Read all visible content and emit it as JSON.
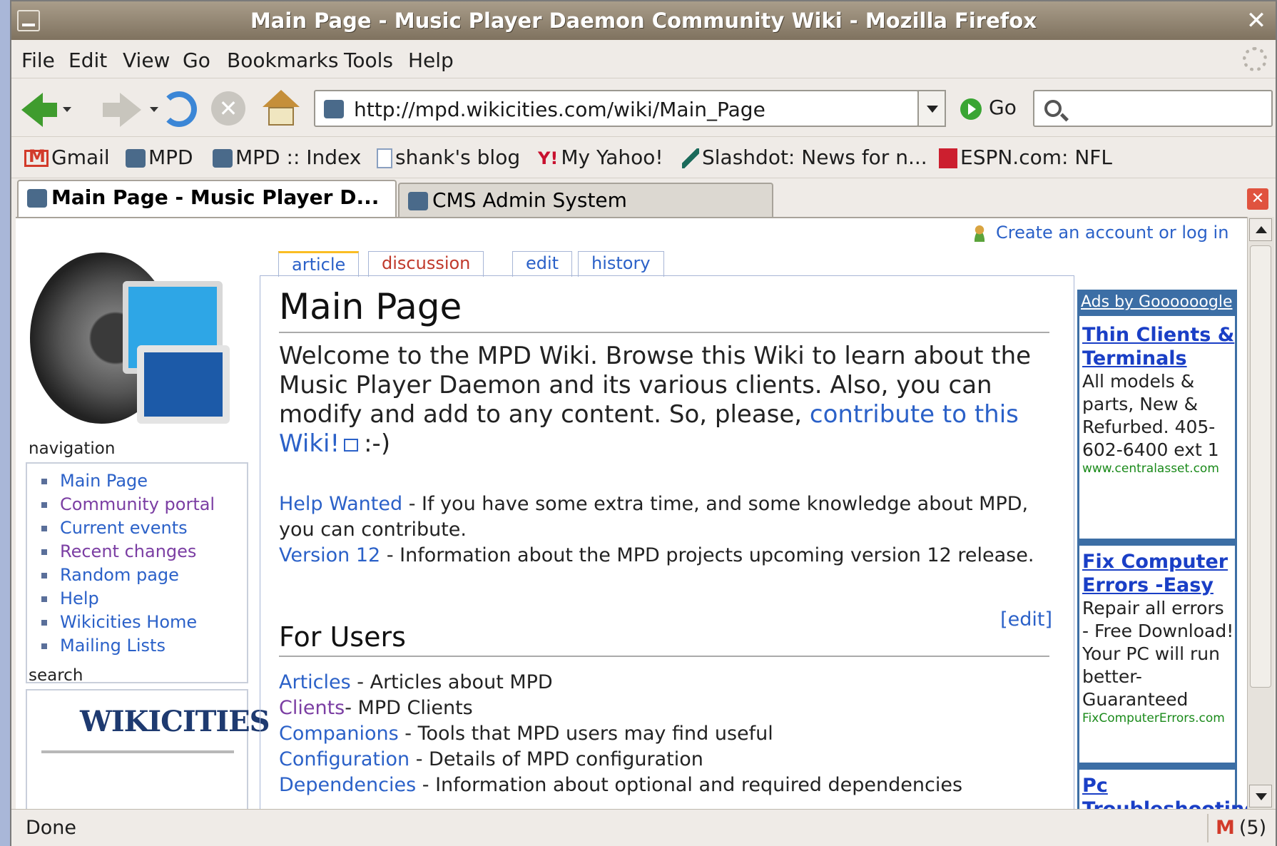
{
  "window": {
    "title": "Main Page - Music Player Daemon Community Wiki - Mozilla Firefox"
  },
  "menubar": [
    "File",
    "Edit",
    "View",
    "Go",
    "Bookmarks",
    "Tools",
    "Help"
  ],
  "navbar": {
    "url": "http://mpd.wikicities.com/wiki/Main_Page",
    "go_label": "Go"
  },
  "bookmarks": [
    "Gmail",
    "MPD",
    "MPD :: Index",
    "shank's blog",
    "My Yahoo!",
    "Slashdot: News for n...",
    "ESPN.com: NFL"
  ],
  "tabs": [
    {
      "label": "Main Page - Music Player D..."
    },
    {
      "label": "CMS Admin System"
    }
  ],
  "page": {
    "user_link": "Create an account or log in",
    "page_tabs": [
      "article",
      "discussion",
      "edit",
      "history"
    ],
    "navigation_heading": "navigation",
    "navigation": [
      "Main Page",
      "Community portal",
      "Current events",
      "Recent changes",
      "Random page",
      "Help",
      "Wikicities Home",
      "Mailing Lists"
    ],
    "search_heading": "search",
    "search_logo": "WIKICITIES",
    "title": "Main Page",
    "intro": {
      "text": "Welcome to the MPD Wiki. Browse this Wiki to learn about the Music Player Daemon and its various clients. Also, you can modify and add to any content. So, please,",
      "link": "contribute to this Wiki!",
      "tail": ":-)"
    },
    "help_wanted": {
      "link": "Help Wanted",
      "text": "- If you have some extra time, and some knowledge about MPD,",
      "text2": "you can contribute."
    },
    "version12": {
      "link": "Version 12",
      "text": "- Information about the MPD projects upcoming version 12 release."
    },
    "edit_section": "[edit]",
    "for_users_heading": "For Users",
    "for_users": [
      {
        "link": "Articles",
        "text": "- Articles about MPD"
      },
      {
        "link": "Clients",
        "text": "- MPD Clients"
      },
      {
        "link": "Companions",
        "text": "- Tools that MPD users may find useful"
      },
      {
        "link": "Configuration",
        "text": "- Details of MPD configuration"
      },
      {
        "link": "Dependencies",
        "text": "- Information about optional and required dependencies"
      }
    ]
  },
  "ads": {
    "header": "Ads by Goooooogle",
    "items": [
      {
        "title": "Thin Clients & Terminals",
        "body": "All models & parts, New & Refurbed. 405-602-6400 ext 1",
        "url": "www.centralasset.com"
      },
      {
        "title": "Fix Computer Errors -Easy",
        "body": "Repair all errors - Free Download! Your PC will run better- Guaranteed",
        "url": "FixComputerErrors.com"
      },
      {
        "title": "Pc Troubleshooting",
        "body": "",
        "url": ""
      }
    ]
  },
  "statusbar": {
    "status": "Done",
    "gmail_count": "(5)"
  },
  "colors": {
    "link": "#2b61c8",
    "visited_link": "#7b3ea3",
    "ad_border": "#3c6ea5",
    "titlebar": "#8f8370"
  }
}
